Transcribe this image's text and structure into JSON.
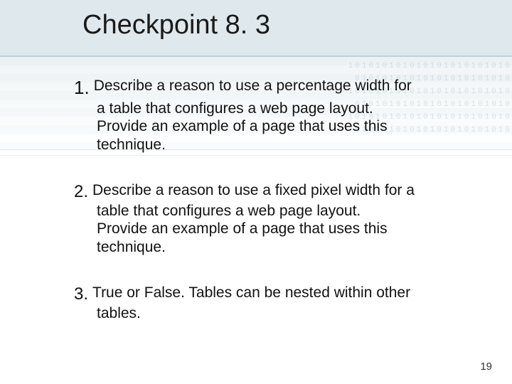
{
  "title": "Checkpoint 8. 3",
  "items": [
    {
      "num": "1.",
      "line1": "Describe a reason to use a percentage width for",
      "line2": "a table that configures a web page layout.",
      "line3": "Provide an example of a page that uses this",
      "line4": "technique."
    },
    {
      "num": "2.",
      "line1": "Describe a reason to use a fixed pixel width for a",
      "line2": "table that configures a web page layout.",
      "line3": "Provide an example of a page that uses this",
      "line4": "technique."
    },
    {
      "num": "3.",
      "line1": "True or False. Tables can be nested within other",
      "line2": "tables."
    }
  ],
  "page_number": "19",
  "deco_binary": "101010101010101010101010\n01010101010101010101010\n101010101010101010101010\n01010101010101010101010\n101010101010101010101010\n01010101010101010101010"
}
